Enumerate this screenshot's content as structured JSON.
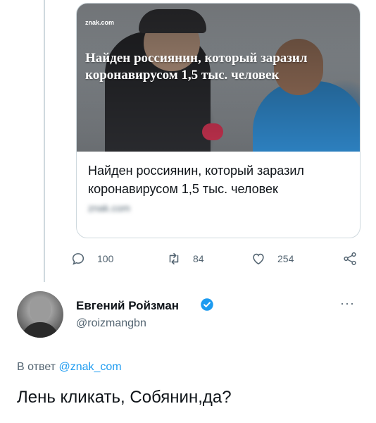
{
  "link_card": {
    "source_logo": "znak.com",
    "image_headline": "Найден россиянин, который заразил коронавирусом 1,5 тыс. человек",
    "title": "Найден россиянин, который заразил коронавирусом 1,5 тыс. человек",
    "domain": "znak.com"
  },
  "actions": {
    "replies": "100",
    "retweets": "84",
    "likes": "254"
  },
  "reply_tweet": {
    "author_name": "Евгений Ройзман",
    "handle": "@roizmangbn",
    "reply_prefix": "В ответ ",
    "reply_to": "@znak_com",
    "text": "Лень кликать, Собянин,да?",
    "more_label": "···"
  },
  "colors": {
    "accent": "#1d9bf0",
    "secondary_text": "#536471",
    "border": "#cfd9de"
  }
}
